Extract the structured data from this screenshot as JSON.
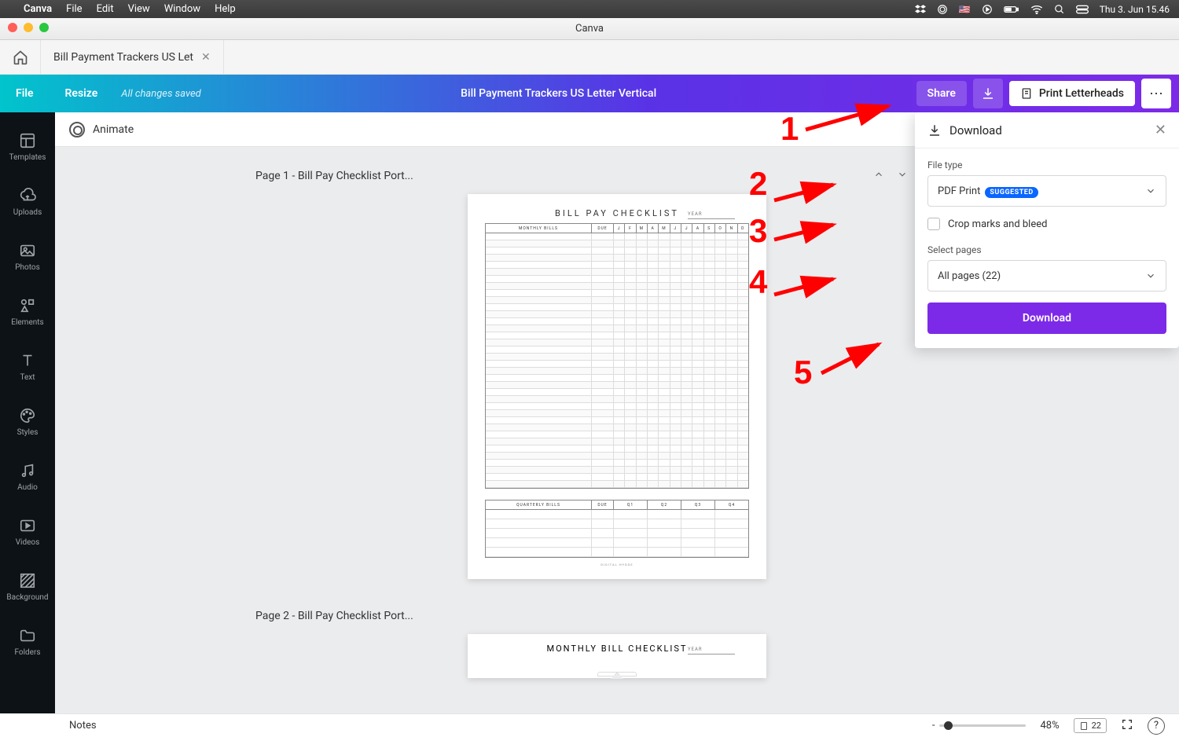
{
  "menubar": {
    "app": "Canva",
    "items": [
      "File",
      "Edit",
      "View",
      "Window",
      "Help"
    ],
    "clock": "Thu 3. Jun  15.46"
  },
  "window": {
    "title": "Canva"
  },
  "tab": {
    "label": "Bill Payment Trackers US Let"
  },
  "toolbar": {
    "file": "File",
    "resize": "Resize",
    "saved": "All changes saved",
    "doc_title": "Bill Payment Trackers US Letter Vertical",
    "share": "Share",
    "print": "Print Letterheads"
  },
  "context": {
    "animate": "Animate"
  },
  "sidebar_items": [
    {
      "label": "Templates"
    },
    {
      "label": "Uploads"
    },
    {
      "label": "Photos"
    },
    {
      "label": "Elements"
    },
    {
      "label": "Text"
    },
    {
      "label": "Styles"
    },
    {
      "label": "Audio"
    },
    {
      "label": "Videos"
    },
    {
      "label": "Background"
    },
    {
      "label": "Folders"
    }
  ],
  "page1": {
    "head": "Page 1 - Bill Pay Checklist Port...",
    "title": "BILL PAY CHECKLIST",
    "year": "YEAR",
    "cols": {
      "monthly": "MONTHLY BILLS",
      "due": "DUE",
      "months": [
        "J",
        "F",
        "M",
        "A",
        "M",
        "J",
        "J",
        "A",
        "S",
        "O",
        "N",
        "D"
      ]
    },
    "q": {
      "label": "QUARTERLY BILLS",
      "due": "DUE",
      "quarters": [
        "Q1",
        "Q2",
        "Q3",
        "Q4"
      ]
    },
    "brand": "DIGITAL HYGGE"
  },
  "page2": {
    "head": "Page 2 - Bill Pay Checklist Port...",
    "title": "MONTHLY BILL CHECKLIST",
    "year": "YEAR"
  },
  "download": {
    "title": "Download",
    "file_type_label": "File type",
    "file_type_value": "PDF Print",
    "suggested": "SUGGESTED",
    "crop": "Crop marks and bleed",
    "select_pages_label": "Select pages",
    "select_pages_value": "All pages (22)",
    "button": "Download"
  },
  "annotations": [
    "1",
    "2",
    "3",
    "4",
    "5"
  ],
  "status": {
    "notes": "Notes",
    "zoom": "48%",
    "pages": "22"
  }
}
